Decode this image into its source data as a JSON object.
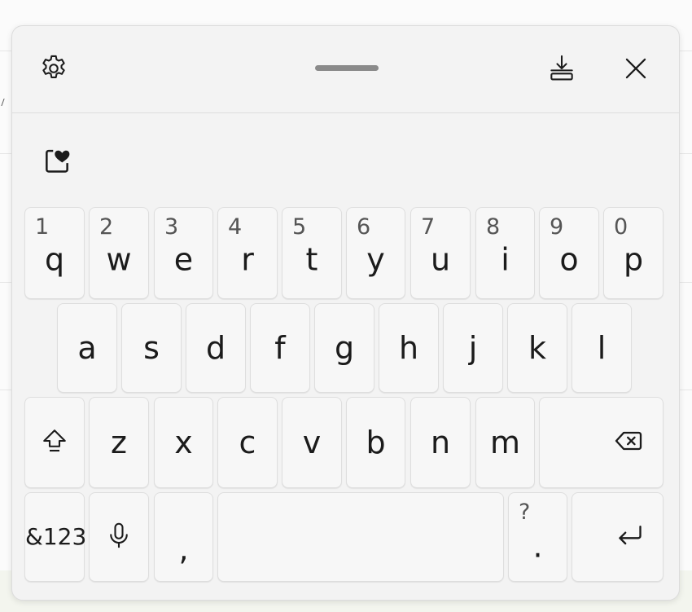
{
  "keyboard": {
    "title_icons": [
      "gear-icon",
      "drag-handle",
      "dock-icon",
      "close-icon"
    ],
    "clipboard_icon": "clipboard-heart-icon",
    "row1": [
      {
        "key": "q",
        "hint": "1"
      },
      {
        "key": "w",
        "hint": "2"
      },
      {
        "key": "e",
        "hint": "3"
      },
      {
        "key": "r",
        "hint": "4"
      },
      {
        "key": "t",
        "hint": "5"
      },
      {
        "key": "y",
        "hint": "6"
      },
      {
        "key": "u",
        "hint": "7"
      },
      {
        "key": "i",
        "hint": "8"
      },
      {
        "key": "o",
        "hint": "9"
      },
      {
        "key": "p",
        "hint": "0"
      }
    ],
    "row2": [
      "a",
      "s",
      "d",
      "f",
      "g",
      "h",
      "j",
      "k",
      "l"
    ],
    "row3": [
      "z",
      "x",
      "c",
      "v",
      "b",
      "n",
      "m"
    ],
    "row4": {
      "symbols_label": "&123",
      "comma": ",",
      "period": ".",
      "period_hint": "?"
    },
    "icons": {
      "shift": "shift-icon",
      "backspace": "backspace-icon",
      "mic": "microphone-icon",
      "enter": "enter-icon"
    }
  }
}
